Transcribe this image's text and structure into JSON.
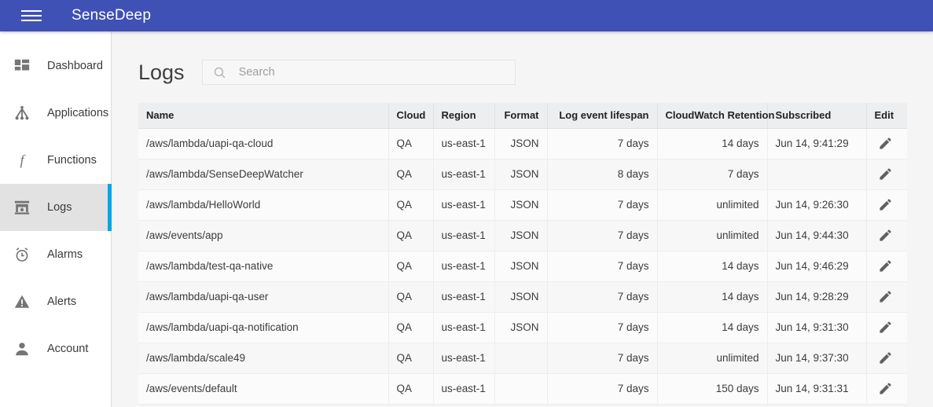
{
  "appbar": {
    "menu_icon": "hamburger-menu-icon",
    "title": "SenseDeep",
    "background_color": "#3f51b5"
  },
  "sidebar": {
    "active_indicator_color": "#03a5e8",
    "items": [
      {
        "label": "Dashboard",
        "icon": "dashboard-icon",
        "active": false
      },
      {
        "label": "Applications",
        "icon": "hierarchy-icon",
        "active": false
      },
      {
        "label": "Functions",
        "icon": "function-f-icon",
        "active": false
      },
      {
        "label": "Logs",
        "icon": "fireplace-icon",
        "active": true
      },
      {
        "label": "Alarms",
        "icon": "alarm-clock-icon",
        "active": false
      },
      {
        "label": "Alerts",
        "icon": "warning-triangle-icon",
        "active": false
      },
      {
        "label": "Account",
        "icon": "person-icon",
        "active": false
      }
    ]
  },
  "page": {
    "title": "Logs"
  },
  "search": {
    "placeholder": "Search",
    "value": "",
    "icon": "search-icon"
  },
  "table": {
    "columns": [
      {
        "label": "Name",
        "align": "left"
      },
      {
        "label": "Cloud",
        "align": "left"
      },
      {
        "label": "Region",
        "align": "left"
      },
      {
        "label": "Format",
        "align": "right"
      },
      {
        "label": "Log event lifespan",
        "align": "right"
      },
      {
        "label": "CloudWatch Retention",
        "align": "right"
      },
      {
        "label": "Subscribed",
        "align": "left"
      },
      {
        "label": "Edit",
        "align": "left"
      }
    ],
    "rows": [
      {
        "name": "/aws/lambda/uapi-qa-cloud",
        "cloud": "QA",
        "region": "us-east-1",
        "format": "JSON",
        "lifespan": "7 days",
        "retention": "14 days",
        "subscribed": "Jun 14, 9:41:29",
        "edit_icon": "edit-pencil-icon"
      },
      {
        "name": "/aws/lambda/SenseDeepWatcher",
        "cloud": "QA",
        "region": "us-east-1",
        "format": "JSON",
        "lifespan": "8 days",
        "retention": "7 days",
        "subscribed": "",
        "edit_icon": "edit-pencil-icon"
      },
      {
        "name": "/aws/lambda/HelloWorld",
        "cloud": "QA",
        "region": "us-east-1",
        "format": "JSON",
        "lifespan": "7 days",
        "retention": "unlimited",
        "subscribed": "Jun 14, 9:26:30",
        "edit_icon": "edit-pencil-icon"
      },
      {
        "name": "/aws/events/app",
        "cloud": "QA",
        "region": "us-east-1",
        "format": "JSON",
        "lifespan": "7 days",
        "retention": "unlimited",
        "subscribed": "Jun 14, 9:44:30",
        "edit_icon": "edit-pencil-icon"
      },
      {
        "name": "/aws/lambda/test-qa-native",
        "cloud": "QA",
        "region": "us-east-1",
        "format": "JSON",
        "lifespan": "7 days",
        "retention": "14 days",
        "subscribed": "Jun 14, 9:46:29",
        "edit_icon": "edit-pencil-icon"
      },
      {
        "name": "/aws/lambda/uapi-qa-user",
        "cloud": "QA",
        "region": "us-east-1",
        "format": "JSON",
        "lifespan": "7 days",
        "retention": "14 days",
        "subscribed": "Jun 14, 9:28:29",
        "edit_icon": "edit-pencil-icon"
      },
      {
        "name": "/aws/lambda/uapi-qa-notification",
        "cloud": "QA",
        "region": "us-east-1",
        "format": "JSON",
        "lifespan": "7 days",
        "retention": "14 days",
        "subscribed": "Jun 14, 9:31:30",
        "edit_icon": "edit-pencil-icon"
      },
      {
        "name": "/aws/lambda/scale49",
        "cloud": "QA",
        "region": "us-east-1",
        "format": "",
        "lifespan": "7 days",
        "retention": "unlimited",
        "subscribed": "Jun 14, 9:37:30",
        "edit_icon": "edit-pencil-icon"
      },
      {
        "name": "/aws/events/default",
        "cloud": "QA",
        "region": "us-east-1",
        "format": "",
        "lifespan": "7 days",
        "retention": "150 days",
        "subscribed": "Jun 14, 9:31:31",
        "edit_icon": "edit-pencil-icon"
      }
    ]
  }
}
